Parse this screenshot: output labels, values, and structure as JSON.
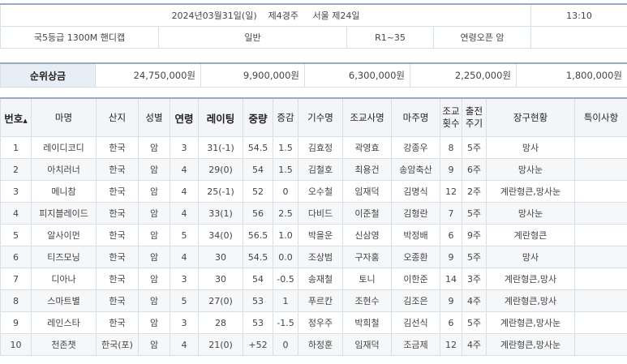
{
  "race_info": {
    "date": "2024년03월31일(일)",
    "race_no": "제4경주",
    "venue": "서울 제24일",
    "time": "13:10",
    "grade_distance": "국5등급  1300M  핸디캡",
    "type": "일반",
    "rating": "R1~35",
    "conditions": "연령오픈 암"
  },
  "prize": {
    "label": "순위상금",
    "amounts": [
      "24,750,000원",
      "9,900,000원",
      "6,300,000원",
      "2,250,000원",
      "1,800,000원"
    ]
  },
  "table": {
    "headers": {
      "no": "번호",
      "no_sort": "▲",
      "name": "마명",
      "origin": "산지",
      "sex": "성별",
      "age": "연령",
      "rating": "레이팅",
      "weight": "중량",
      "weight_change": "증감",
      "jockey": "기수명",
      "trainer": "조교사명",
      "owner": "마주명",
      "train_count_1": "조교",
      "train_count_2": "횟수",
      "interval_1": "출전",
      "interval_2": "주기",
      "equipment": "장구현황",
      "notes": "특이사항"
    },
    "rows": [
      {
        "no": "1",
        "name": "레이디코디",
        "origin": "한국",
        "sex": "암",
        "age": "3",
        "rating": "31(-1)",
        "weight": "54.5",
        "change": "1.5",
        "jockey": "김효정",
        "trainer": "곽영효",
        "owner": "강종우",
        "count": "8",
        "interval": "5주",
        "equipment": "망사",
        "notes": ""
      },
      {
        "no": "2",
        "name": "아치러너",
        "origin": "한국",
        "sex": "암",
        "age": "4",
        "rating": "29(0)",
        "weight": "54",
        "change": "1.5",
        "jockey": "김철호",
        "trainer": "최용건",
        "owner": "송암축산",
        "count": "9",
        "interval": "6주",
        "equipment": "망사눈",
        "notes": ""
      },
      {
        "no": "3",
        "name": "메니참",
        "origin": "한국",
        "sex": "암",
        "age": "4",
        "rating": "25(-1)",
        "weight": "52",
        "change": "0",
        "jockey": "오수철",
        "trainer": "임재덕",
        "owner": "김명식",
        "count": "12",
        "interval": "2주",
        "equipment": "계란형큰,망사눈",
        "notes": ""
      },
      {
        "no": "4",
        "name": "피지블레이드",
        "origin": "한국",
        "sex": "암",
        "age": "4",
        "rating": "33(1)",
        "weight": "56",
        "change": "2.5",
        "jockey": "다비드",
        "trainer": "이준철",
        "owner": "김형란",
        "count": "7",
        "interval": "5주",
        "equipment": "망사눈",
        "notes": ""
      },
      {
        "no": "5",
        "name": "알사이먼",
        "origin": "한국",
        "sex": "암",
        "age": "5",
        "rating": "34(0)",
        "weight": "56.5",
        "change": "1.0",
        "jockey": "박을운",
        "trainer": "신삼영",
        "owner": "박정배",
        "count": "6",
        "interval": "9주",
        "equipment": "계란형큰",
        "notes": ""
      },
      {
        "no": "6",
        "name": "티즈모닝",
        "origin": "한국",
        "sex": "암",
        "age": "4",
        "rating": "30",
        "weight": "54.5",
        "change": "0.0",
        "jockey": "조상범",
        "trainer": "구자홍",
        "owner": "오종환",
        "count": "9",
        "interval": "5주",
        "equipment": "망사",
        "notes": ""
      },
      {
        "no": "7",
        "name": "디아나",
        "origin": "한국",
        "sex": "암",
        "age": "3",
        "rating": "30",
        "weight": "54",
        "change": "-0.5",
        "jockey": "송재철",
        "trainer": "토니",
        "owner": "이한준",
        "count": "14",
        "interval": "3주",
        "equipment": "계란형큰,망사",
        "notes": ""
      },
      {
        "no": "8",
        "name": "스마트별",
        "origin": "한국",
        "sex": "암",
        "age": "5",
        "rating": "27(0)",
        "weight": "53",
        "change": "1",
        "jockey": "푸르칸",
        "trainer": "조현수",
        "owner": "김조은",
        "count": "9",
        "interval": "4주",
        "equipment": "계란형큰,망사",
        "notes": ""
      },
      {
        "no": "9",
        "name": "레인스타",
        "origin": "한국",
        "sex": "암",
        "age": "3",
        "rating": "28",
        "weight": "53",
        "change": "-1.5",
        "jockey": "정우주",
        "trainer": "박희철",
        "owner": "김선식",
        "count": "6",
        "interval": "5주",
        "equipment": "계란형큰,망사눈",
        "notes": ""
      },
      {
        "no": "10",
        "name": "천존챗",
        "origin": "한국(포)",
        "sex": "암",
        "age": "4",
        "rating": "21(0)",
        "weight": "+52",
        "change": "0",
        "jockey": "하정훈",
        "trainer": "임재덕",
        "owner": "조금제",
        "count": "12",
        "interval": "4주",
        "equipment": "계란형큰,망사눈",
        "notes": ""
      }
    ]
  },
  "colors": {
    "link": "#2a5bb8",
    "header_bg": "#f3f5f8",
    "label_bg": "#e8eef6",
    "border": "#d9dfe7",
    "top_rule": "#9aaac2"
  }
}
